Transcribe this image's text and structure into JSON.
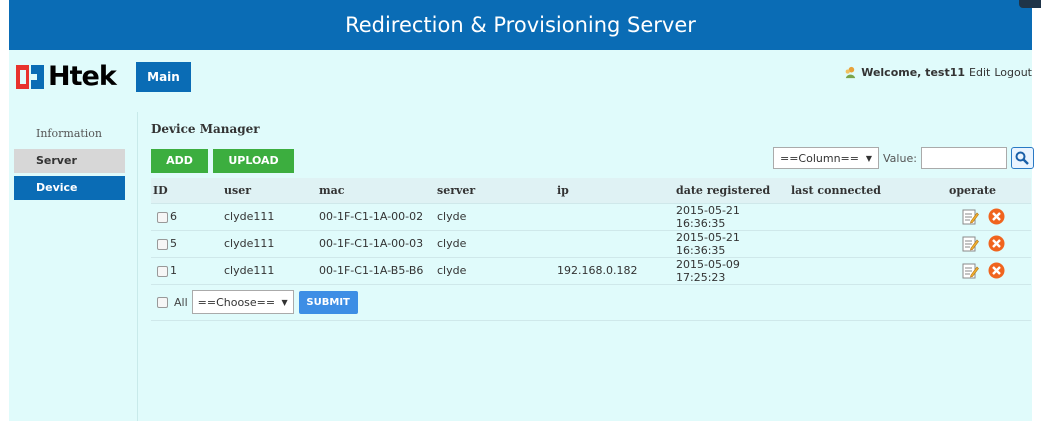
{
  "banner": {
    "title": "Redirection & Provisioning Server"
  },
  "header": {
    "logo_text": "Htek",
    "main_tab": "Main",
    "welcome": "Welcome, test11",
    "edit_link": "Edit",
    "logout_link": "Logout"
  },
  "sidebar": {
    "items": [
      {
        "label": "Information"
      },
      {
        "label": "Server"
      },
      {
        "label": "Device"
      }
    ]
  },
  "content": {
    "title": "Device Manager",
    "add_button": "ADD",
    "upload_button": "UPLOAD",
    "search": {
      "column_select": "==Column==",
      "value_label": "Value:",
      "value_input": ""
    },
    "table": {
      "headers": [
        "ID",
        "user",
        "mac",
        "server",
        "ip",
        "date registered",
        "last connected",
        "operate"
      ],
      "rows": [
        {
          "id": "6",
          "user": "clyde111",
          "mac": "00-1F-C1-1A-00-02",
          "server": "clyde",
          "ip": "",
          "date_registered": "2015-05-21 16:36:35",
          "last_connected": ""
        },
        {
          "id": "5",
          "user": "clyde111",
          "mac": "00-1F-C1-1A-00-03",
          "server": "clyde",
          "ip": "",
          "date_registered": "2015-05-21 16:36:35",
          "last_connected": ""
        },
        {
          "id": "1",
          "user": "clyde111",
          "mac": "00-1F-C1-1A-B5-B6",
          "server": "clyde",
          "ip": "192.168.0.182",
          "date_registered": "2015-05-09 17:25:23",
          "last_connected": ""
        }
      ]
    },
    "footer": {
      "all_label": "All",
      "choose_select": "==Choose==",
      "submit_button": "SUBMIT"
    }
  },
  "colors": {
    "brand_blue": "#0a6cb5",
    "page_bg": "#e0fbfb",
    "green_button": "#3cae3f",
    "submit_blue": "#3d8ee5",
    "logo_red": "#e8322d"
  },
  "icons": {
    "user": "user-icon",
    "search": "search-icon",
    "edit": "edit-icon",
    "delete": "delete-icon"
  }
}
